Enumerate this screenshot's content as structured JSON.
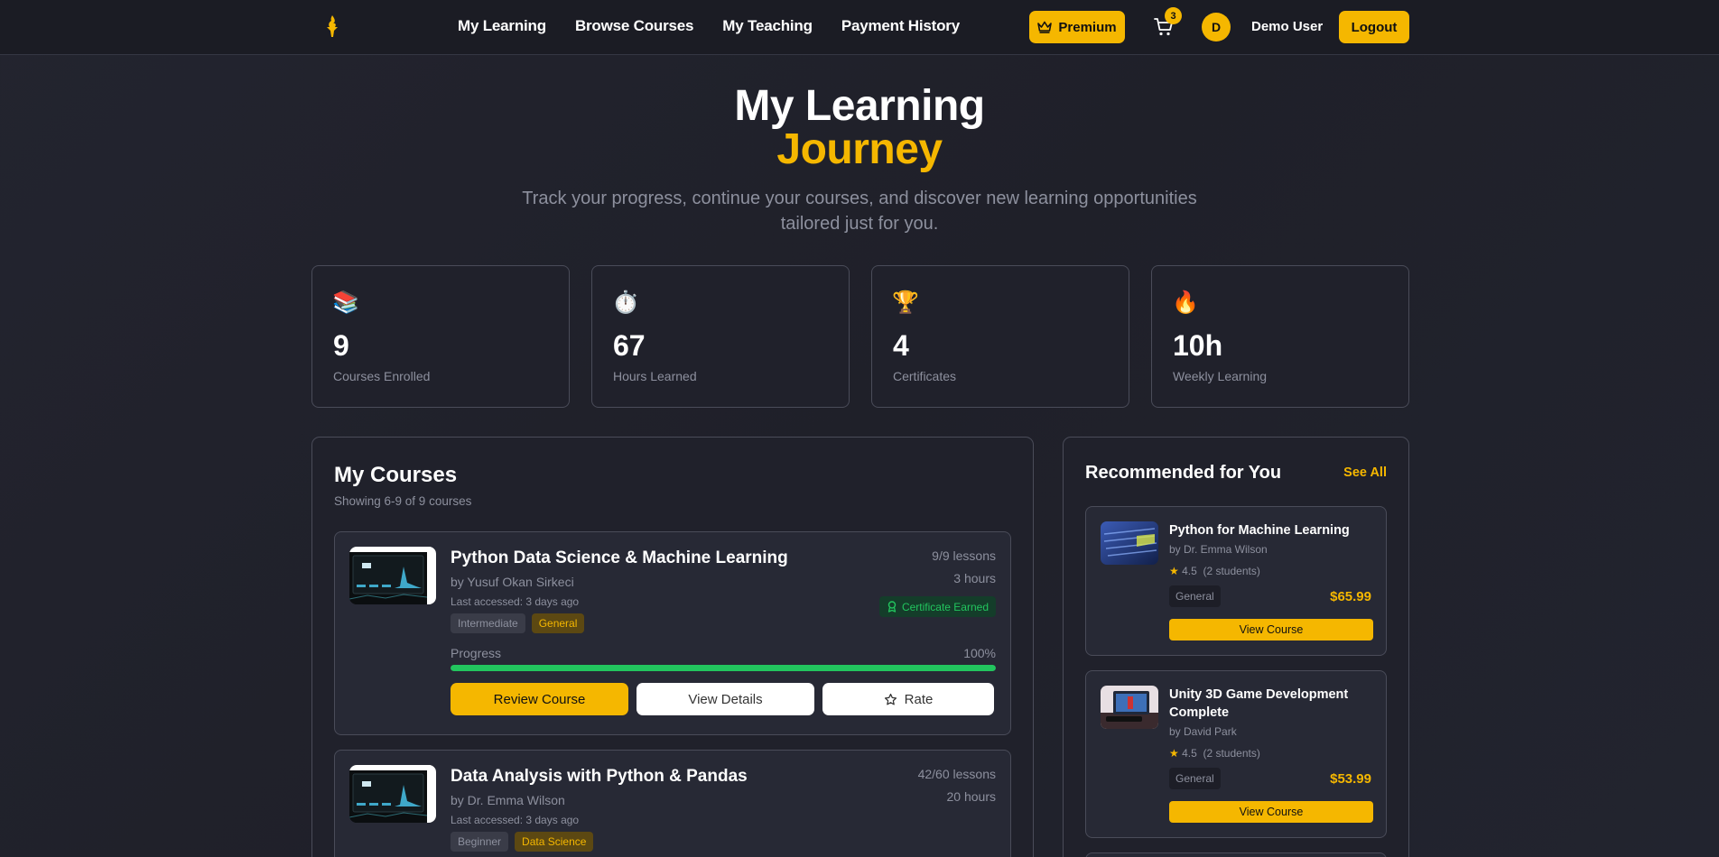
{
  "nav": {
    "links": [
      "My Learning",
      "Browse Courses",
      "My Teaching",
      "Payment History"
    ],
    "premium_label": "Premium",
    "cart_count": "3",
    "avatar_initial": "D",
    "user_name": "Demo User",
    "logout_label": "Logout"
  },
  "hero": {
    "title_line1": "My Learning",
    "title_line2": "Journey",
    "subtitle": "Track your progress, continue your courses, and discover new learning opportunities tailored just for you."
  },
  "stats": [
    {
      "icon": "books-icon",
      "glyph": "📚",
      "value": "9",
      "label": "Courses Enrolled"
    },
    {
      "icon": "stopwatch-icon",
      "glyph": "⏱️",
      "value": "67",
      "label": "Hours Learned"
    },
    {
      "icon": "trophy-icon",
      "glyph": "🏆",
      "value": "4",
      "label": "Certificates"
    },
    {
      "icon": "fire-icon",
      "glyph": "🔥",
      "value": "10h",
      "label": "Weekly Learning"
    }
  ],
  "my_courses": {
    "title": "My Courses",
    "subtitle": "Showing 6-9 of 9 courses",
    "courses": [
      {
        "title": "Python Data Science & Machine Learning",
        "author": "by Yusuf Okan Sirkeci",
        "accessed": "Last accessed: 3 days ago",
        "level": "Intermediate",
        "category": "General",
        "lessons": "9/9 lessons",
        "hours": "3 hours",
        "certificate": "Certificate Earned",
        "progress_label": "Progress",
        "progress_pct": "100%",
        "progress_value": 100,
        "primary_btn": "Review Course",
        "details_btn": "View Details",
        "rate_btn": "Rate"
      },
      {
        "title": "Data Analysis with Python & Pandas",
        "author": "by Dr. Emma Wilson",
        "accessed": "Last accessed: 3 days ago",
        "level": "Beginner",
        "category": "Data Science",
        "lessons": "42/60 lessons",
        "hours": "20 hours"
      }
    ]
  },
  "recommended": {
    "title": "Recommended for You",
    "see_all": "See All",
    "items": [
      {
        "title": "Python for Machine Learning",
        "author": "by Dr. Emma Wilson",
        "rating": "4.5",
        "students": "(2 students)",
        "tag": "General",
        "price": "$65.99",
        "btn": "View Course"
      },
      {
        "title": "Unity 3D Game Development Complete",
        "author": "by David Park",
        "rating": "4.5",
        "students": "(2 students)",
        "tag": "General",
        "price": "$53.99",
        "btn": "View Course"
      }
    ]
  },
  "colors": {
    "accent": "#f5b700",
    "success": "#22c55e",
    "background": "#22232d",
    "muted_text": "#8d909e"
  }
}
